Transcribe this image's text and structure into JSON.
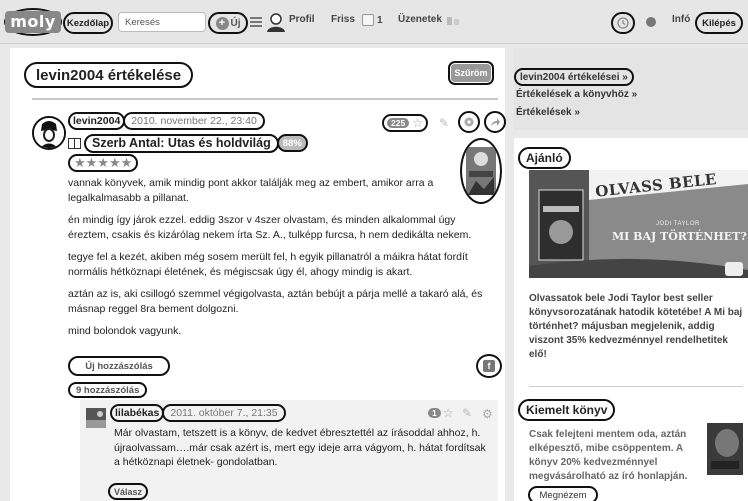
{
  "topbar": {
    "logo": "moly",
    "home": "Kezdőlap",
    "search_placeholder": "Keresés",
    "new_label": "Új",
    "profile": "Profil",
    "fresh": "Friss",
    "message_count": "1",
    "messages": "Üzenetek",
    "info": "Infó",
    "logout": "Kilépés"
  },
  "page": {
    "title": "levin2004 értékelése",
    "filter": "Szűröm"
  },
  "review": {
    "user": "levin2004",
    "date": "2010. november 22., 23:40",
    "like_count": "225",
    "book_title": "Szerb Antal: Utas és holdvilág",
    "book_percent": "88%",
    "stars": "★★★★★",
    "paragraphs": [
      "vannak könyvek, amik mindig pont akkor találják meg az embert, amikor arra a legalkalmasabb a pillanat.",
      "én mindig így járok ezzel. eddig 3szor v 4szer olvastam, és minden alkalommal úgy éreztem, csakis és kizárólag nekem írta Sz. A., tulképp furcsa, h nem dedikálta nekem.",
      "tegye fel a kezét, akiben még sosem merült fel, h egyik pillanatról a máikra hátat fordít normális hétköznapi életének, és mégiscsak úgy él, ahogy mindig is akart.",
      "aztán az is, aki csillogó szemmel végigolvasta, aztán bebújt a párja mellé a takaró alá, és másnap reggel 8ra bement dolgozni.",
      "mind bolondok vagyunk."
    ],
    "new_comment": "Új hozzászólás",
    "facebook": "f",
    "comment_count": "9 hozzászólás"
  },
  "comment": {
    "user": "lilabékas",
    "date": "2011. október 7., 21:35",
    "likes": "1",
    "text": "Már olvastam, tetszett is a könyv, de kedvet ébresztettél az írásoddal ahhoz, h. újraolvassam….már csak azért is, mert egy ideje arra vágyom, h. hátat fordítsak a hétköznapi életnek- gondolatban.",
    "reply": "Válasz"
  },
  "sidebar": {
    "links": [
      "levin2004 értékelései »",
      "Értékelések a könyvhöz »",
      "Értékelések »"
    ],
    "recommend_heading": "Ajánló",
    "promo_banner": "OLVASS BELE",
    "promo_book": "MI BAJ TÖRTÉNHET?",
    "promo_author": "JODI TAYLOR",
    "promo_text": "Olvassatok bele Jodi Taylor best seller könyvsorozatának hatodik kötetébe! A Mi baj történhet? májusban megjelenik, addig viszont 35% kedvezménnyel rendelhetitek elő!",
    "featured_heading": "Kiemelt könyv",
    "featured_text": "Csak felejteni mentem oda, aztán elképesztő, mibe csöppentem. A könyv 20% kedvezménnyel megvásárolható az író honlapján.",
    "look_button": "Megnézem"
  },
  "colors": {
    "page_bg": "#e9e9e9",
    "card_bg": "#ffffff",
    "accent_gray": "#888888",
    "annotation": "#111111"
  }
}
